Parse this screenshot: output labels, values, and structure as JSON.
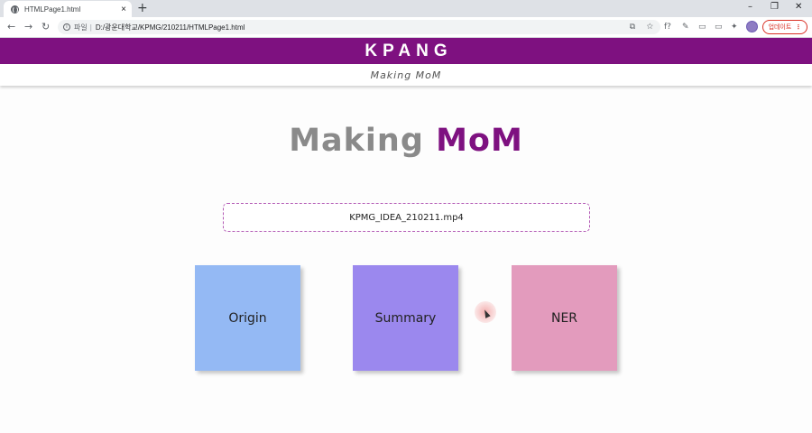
{
  "browser": {
    "tab_title": "HTMLPage1.html",
    "tab_close": "×",
    "new_tab": "+",
    "window_controls": {
      "minimize": "–",
      "restore": "❐",
      "close": "✕"
    },
    "nav": {
      "back": "←",
      "forward": "→",
      "reload": "↻"
    },
    "address": {
      "protocol_label": "파일",
      "separator": "|",
      "url": "D:/광운대학교/KPMG/210211/HTMLPage1.html"
    },
    "omnibox_icons": {
      "translate": "⧉",
      "bookmark": "☆"
    },
    "extensions": [
      "f?",
      "✎",
      "▭",
      "▭",
      "✦"
    ],
    "update_button": {
      "label": "업데이트",
      "menu": "⋮"
    }
  },
  "page": {
    "brand": "KPANG",
    "subtitle": "Making MoM",
    "hero": {
      "word1": "Making",
      "word2": "MoM"
    },
    "file_name": "KPMG_IDEA_210211.mp4",
    "cards": [
      {
        "label": "Origin",
        "color": "#94b9f4"
      },
      {
        "label": "Summary",
        "color": "#9b88ee"
      },
      {
        "label": "NER",
        "color": "#e39bbd"
      }
    ],
    "colors": {
      "brand": "#7e1180",
      "hero_gray": "#8a8a8a",
      "file_border": "#b35ab5"
    }
  }
}
